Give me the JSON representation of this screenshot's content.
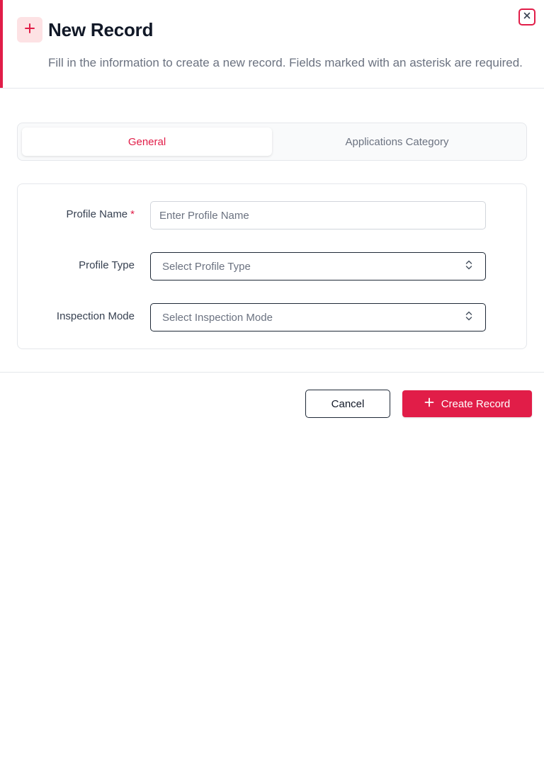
{
  "dialog": {
    "title": "New Record",
    "description": "Fill in the information to create a new record. Fields marked with an asterisk are required.",
    "header_icon": "plus-icon",
    "close_icon": "close-icon",
    "accent_color": "#e11d48"
  },
  "tabs": [
    {
      "label": "General",
      "active": true
    },
    {
      "label": "Applications Category",
      "active": false
    }
  ],
  "form": {
    "profile_name": {
      "label": "Profile Name",
      "required_marker": "*",
      "placeholder": "Enter Profile Name",
      "value": ""
    },
    "profile_type": {
      "label": "Profile Type",
      "placeholder": "Select Profile Type",
      "icon": "chevron-updown-icon"
    },
    "inspection_mode": {
      "label": "Inspection Mode",
      "placeholder": "Select Inspection Mode",
      "icon": "chevron-updown-icon"
    }
  },
  "footer": {
    "cancel_label": "Cancel",
    "create_label": "Create Record",
    "create_icon": "plus-icon"
  }
}
